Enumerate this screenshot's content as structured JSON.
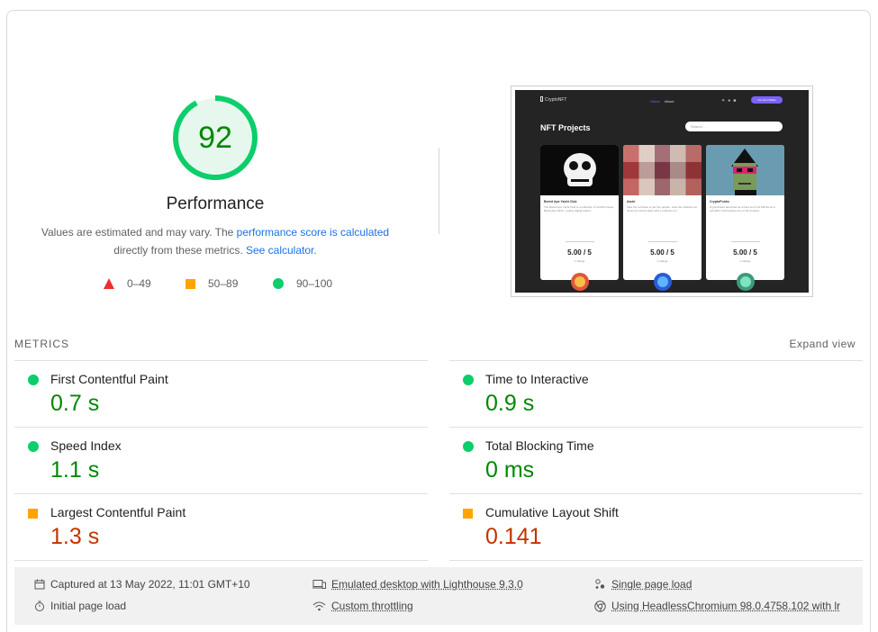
{
  "score": {
    "value": "92",
    "fraction": 0.92,
    "label": "Performance",
    "color": "#008800",
    "ring_color": "#0cce6b"
  },
  "description": {
    "prefix": "Values are estimated and may vary. The ",
    "link1": "performance score is calculated",
    "middle": " directly from these metrics. ",
    "link2": "See calculator."
  },
  "legend": [
    {
      "icon": "triangle-icon",
      "label": "0–49",
      "color": "#eb3030"
    },
    {
      "icon": "square-icon",
      "label": "50–89",
      "color": "#ffa400"
    },
    {
      "icon": "circle-icon",
      "label": "90–100",
      "color": "#0cce6b"
    }
  ],
  "thumbnail": {
    "logo": "CryptoNFT",
    "nav": [
      "Home",
      "About"
    ],
    "connect": "Connect Wallet",
    "title": "NFT Projects",
    "search_placeholder": "Search...",
    "cards": [
      {
        "name": "Bored Ape Yacht Club",
        "blurb": "The Bored Ape Yacht Club is a collection of 10,000 unique Bored Ape NFTs - unique digital collect...",
        "rating": "5.00 / 5",
        "count": "1 ratings"
      },
      {
        "name": "Azuki",
        "blurb": "Take the red bean to join the garden. View the collection at azuki.com Azuki starts with a collection of...",
        "rating": "5.00 / 5",
        "count": "1 ratings"
      },
      {
        "name": "CryptoPunks",
        "blurb": "CryptoPunks launched as a fixed set of 10,000 items in mid-2017 and became one of the inspirat...",
        "rating": "5.00 / 5",
        "count": "1 ratings"
      }
    ]
  },
  "metrics": {
    "title": "METRICS",
    "expand": "Expand view",
    "items": [
      {
        "name": "First Contentful Paint",
        "value": "0.7 s",
        "status": "pass"
      },
      {
        "name": "Time to Interactive",
        "value": "0.9 s",
        "status": "pass"
      },
      {
        "name": "Speed Index",
        "value": "1.1 s",
        "status": "pass"
      },
      {
        "name": "Total Blocking Time",
        "value": "0 ms",
        "status": "pass"
      },
      {
        "name": "Largest Contentful Paint",
        "value": "1.3 s",
        "status": "average"
      },
      {
        "name": "Cumulative Layout Shift",
        "value": "0.141",
        "status": "average"
      }
    ]
  },
  "footer": {
    "captured": "Captured at 13 May 2022, 11:01 GMT+10",
    "initial_load": "Initial page load",
    "emulated": "Emulated desktop with Lighthouse 9.3.0",
    "throttling": "Custom throttling",
    "single_load": "Single page load",
    "browser": "Using HeadlessChromium 98.0.4758.102 with lr"
  }
}
